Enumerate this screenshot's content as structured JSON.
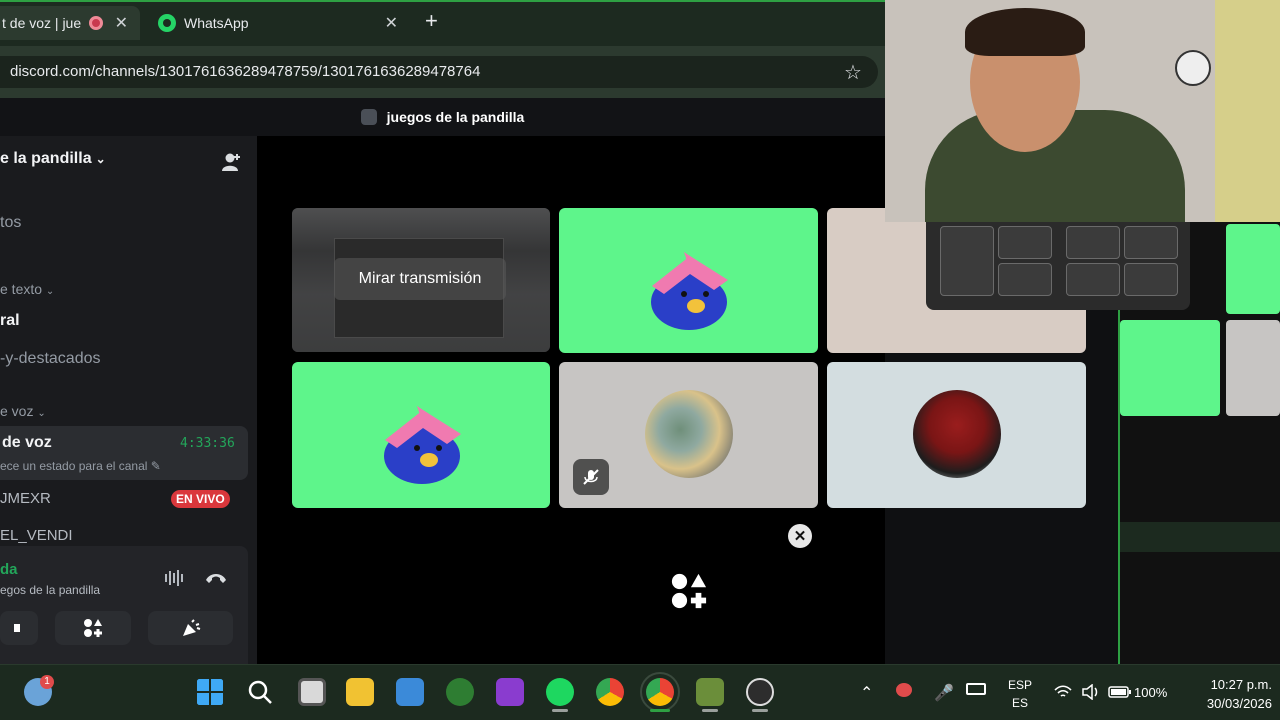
{
  "browser": {
    "tabs": [
      {
        "label": "t de voz | jue"
      },
      {
        "label": "WhatsApp"
      }
    ],
    "new_tab_label": "+",
    "url": "discord.com/channels/1301761636289478759/1301761636289478764",
    "close_glyph": "✕",
    "star_glyph": "☆"
  },
  "discord": {
    "window_title": "juegos de la pandilla",
    "server_name": "e la pandilla",
    "channels": {
      "events": "tos",
      "text_category": "e texto",
      "general": "ral",
      "highlights": "-y-destacados",
      "voice_category": "e voz"
    },
    "voice_channel": {
      "name": "de voz",
      "timer": "4:33:36",
      "status_hint": "ece un estado para el canal"
    },
    "members": [
      {
        "name": "JMEXR",
        "badge": "EN VIVO"
      },
      {
        "name": "EL_VENDI"
      }
    ],
    "voice_panel": {
      "status": "da",
      "channel": "egos de la pandilla"
    },
    "stage": {
      "watch_stream_label": "Mirar transmisión",
      "activity_close": "✕"
    }
  },
  "taskbar": {
    "lang_top": "ESP",
    "lang_bottom": "ES",
    "battery": "100%",
    "time": "10:27 p.m.",
    "date": "30/03/2026",
    "notification_count": "1"
  },
  "colors": {
    "accent_green": "#2ea043",
    "tile_green": "#5ef58b",
    "live_red": "#da373c",
    "voice_green": "#23a55a"
  },
  "icons": [
    "record-icon",
    "whatsapp-icon",
    "star-icon",
    "add-friend-icon",
    "chevron-down-icon",
    "pencil-icon",
    "soundwave-icon",
    "hangup-icon",
    "activity-icon",
    "soundboard-icon",
    "mic-muted-icon",
    "windows-start-icon",
    "search-icon",
    "chrome-icon",
    "spotify-icon",
    "xbox-icon",
    "file-explorer-icon",
    "store-icon",
    "minecraft-icon",
    "obs-icon",
    "wifi-icon",
    "volume-icon",
    "battery-icon",
    "microphone-icon",
    "keyboard-icon"
  ]
}
